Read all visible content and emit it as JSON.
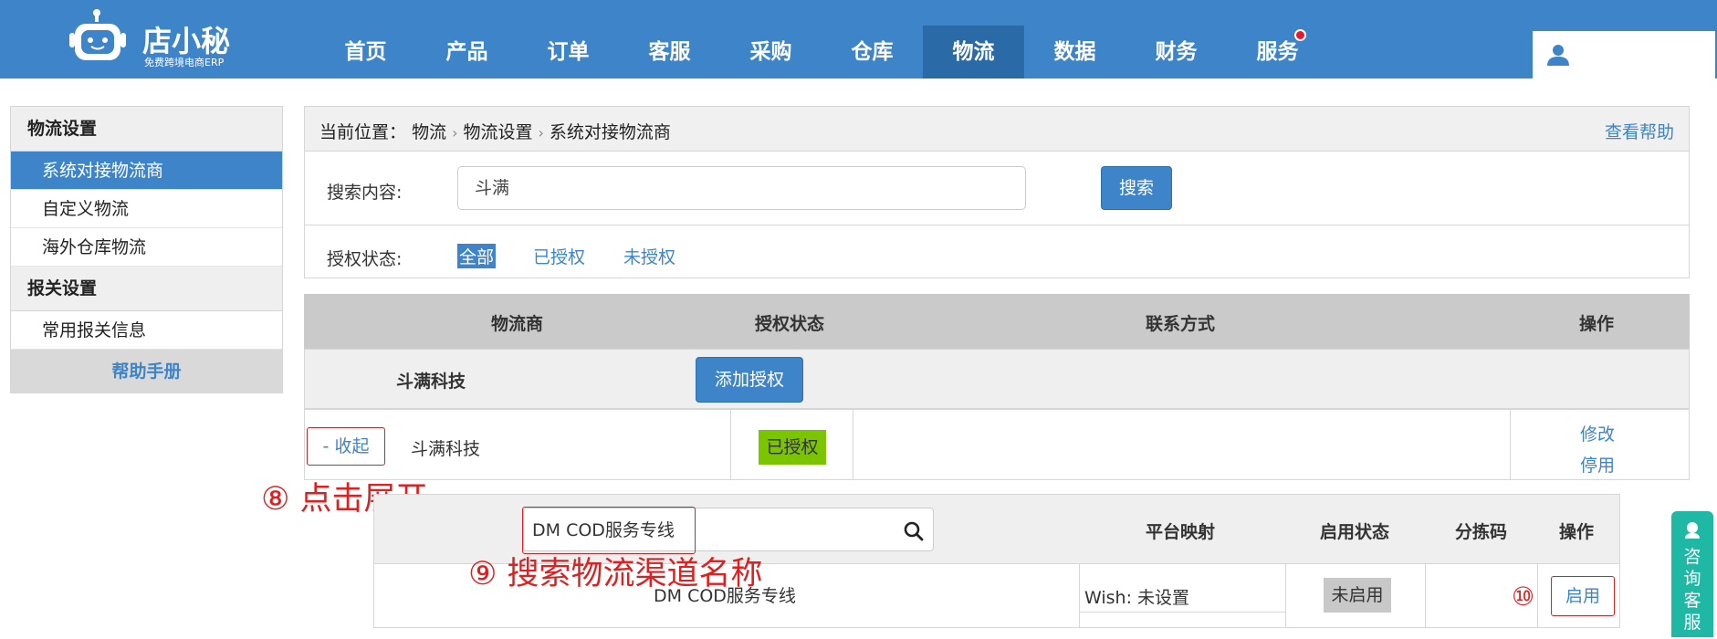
{
  "brand": {
    "name": "店小秘",
    "tagline": "免费跨境电商ERP"
  },
  "nav": {
    "items": [
      "首页",
      "产品",
      "订单",
      "客服",
      "采购",
      "仓库",
      "物流",
      "数据",
      "财务",
      "服务"
    ],
    "active": "物流"
  },
  "sidebar": {
    "group1": "物流设置",
    "items1": [
      "系统对接物流商",
      "自定义物流",
      "海外仓库物流"
    ],
    "group2": "报关设置",
    "items2": [
      "常用报关信息"
    ],
    "help": "帮助手册"
  },
  "breadcrumb": {
    "label": "当前位置：",
    "parts": [
      "物流",
      "物流设置",
      "系统对接物流商"
    ],
    "help_link": "查看帮助"
  },
  "search": {
    "label": "搜索内容:",
    "value": "斗满",
    "button": "搜索"
  },
  "auth_filter": {
    "label": "授权状态:",
    "options": [
      "全部",
      "已授权",
      "未授权"
    ]
  },
  "table": {
    "headers": [
      "物流商",
      "授权状态",
      "联系方式",
      "操作"
    ],
    "group": {
      "name": "斗满科技",
      "button": "添加授权"
    },
    "row": {
      "toggle": "- 收起",
      "name": "斗满科技",
      "status": "已授权",
      "ops": [
        "修改",
        "停用"
      ]
    }
  },
  "sub_table": {
    "search_value": "DM COD服务专线",
    "headers": [
      "平台映射",
      "启用状态",
      "分拣码",
      "操作"
    ],
    "row": {
      "name": "DM COD服务专线",
      "platform": "Wish:",
      "platform_value": "未设置",
      "status": "未启用",
      "action": "启用"
    }
  },
  "annotations": {
    "step8": "⑧ 点击展开",
    "step9": "⑨ 搜索物流渠道名称",
    "step10": "⑩"
  },
  "consult": "咨询客服",
  "colors": {
    "header": "#3d84c8",
    "nav_active": "#2a6aa7",
    "authorized": "#7ac400",
    "annotation": "#e02020",
    "consult": "#1fb8a5"
  }
}
